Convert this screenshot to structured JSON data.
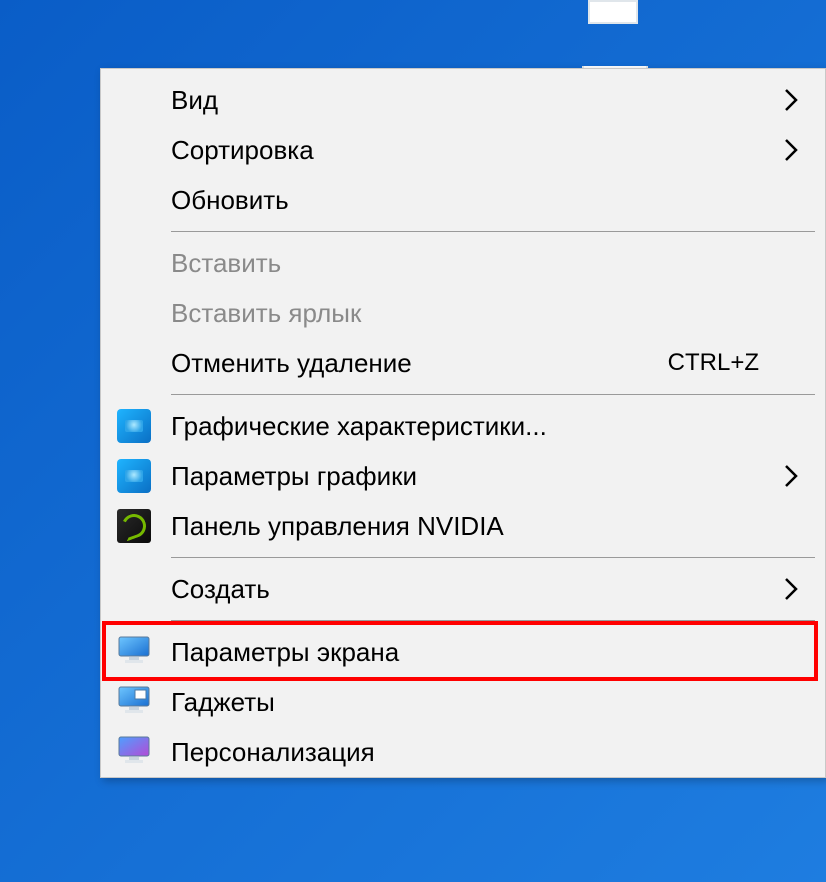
{
  "menu": {
    "groups": [
      [
        {
          "id": "view",
          "label": "Вид",
          "submenu": true
        },
        {
          "id": "sort",
          "label": "Сортировка",
          "submenu": true
        },
        {
          "id": "refresh",
          "label": "Обновить"
        }
      ],
      [
        {
          "id": "paste",
          "label": "Вставить",
          "disabled": true
        },
        {
          "id": "paste-shortcut",
          "label": "Вставить ярлык",
          "disabled": true
        },
        {
          "id": "undo-delete",
          "label": "Отменить удаление",
          "shortcut": "CTRL+Z"
        }
      ],
      [
        {
          "id": "graphics-props",
          "label": "Графические характеристики...",
          "icon": "intel"
        },
        {
          "id": "graphics-options",
          "label": "Параметры графики",
          "icon": "intel",
          "submenu": true
        },
        {
          "id": "nvidia-panel",
          "label": "Панель управления NVIDIA",
          "icon": "nvidia"
        }
      ],
      [
        {
          "id": "new",
          "label": "Создать",
          "submenu": true
        }
      ],
      [
        {
          "id": "display-settings",
          "label": "Параметры экрана",
          "icon": "monitor-blue",
          "highlight": true
        },
        {
          "id": "gadgets",
          "label": "Гаджеты",
          "icon": "monitor-small"
        },
        {
          "id": "personalize",
          "label": "Персонализация",
          "icon": "monitor-purple"
        }
      ]
    ]
  }
}
